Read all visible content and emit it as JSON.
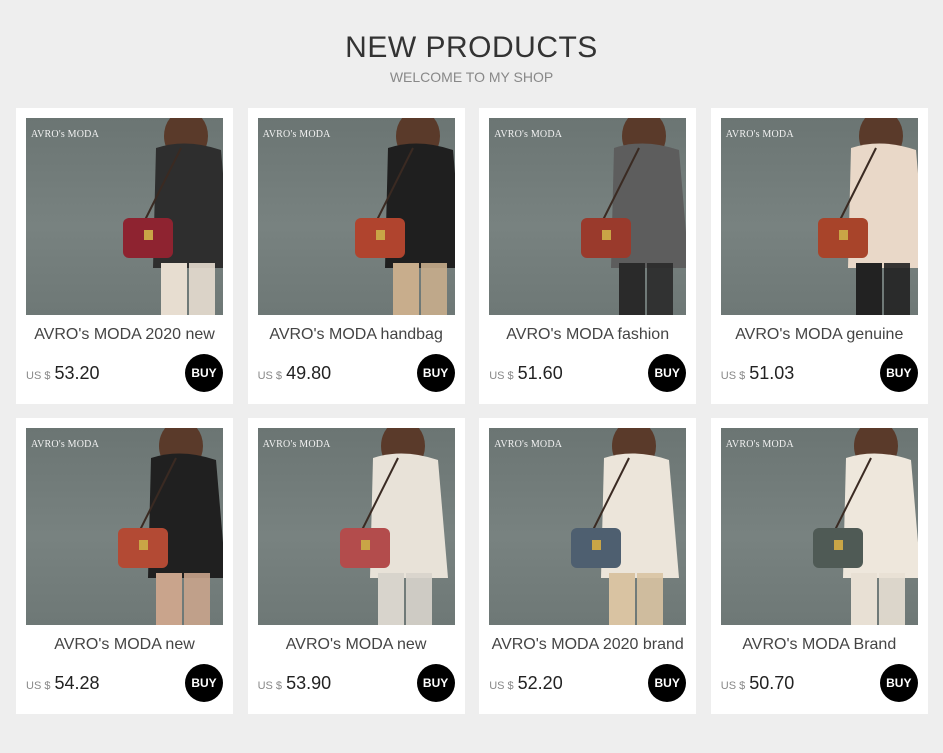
{
  "header": {
    "title": "NEW PRODUCTS",
    "subtitle": "WELCOME TO MY SHOP"
  },
  "buy_label": "BUY",
  "currency": "US $",
  "products": [
    {
      "name": "AVRO's MODA 2020 new",
      "price": "53.20",
      "watermark": "AVRO's MODA",
      "bag_color": "#8e2330",
      "coat_color": "#2e2e2e",
      "pants_color": "#e7ddd0"
    },
    {
      "name": "AVRO's MODA handbag",
      "price": "49.80",
      "watermark": "AVRO's MODA",
      "bag_color": "#b0442e",
      "coat_color": "#1f1f1f",
      "pants_color": "#c8ad8c"
    },
    {
      "name": "AVRO's MODA fashion",
      "price": "51.60",
      "watermark": "AVRO's MODA",
      "bag_color": "#9a3a2c",
      "coat_color": "#5d5d5d",
      "pants_color": "#2a2a2a"
    },
    {
      "name": "AVRO's MODA genuine",
      "price": "51.03",
      "watermark": "AVRO's MODA",
      "bag_color": "#a8442a",
      "coat_color": "#e9d8c8",
      "pants_color": "#222222"
    },
    {
      "name": "AVRO's MODA new",
      "price": "54.28",
      "watermark": "AVRO's MODA",
      "bag_color": "#b34a34",
      "coat_color": "#202020",
      "pants_color": "#c9a48c"
    },
    {
      "name": "AVRO's MODA new",
      "price": "53.90",
      "watermark": "AVRO's MODA",
      "bag_color": "#b34c4c",
      "coat_color": "#e8e2d8",
      "pants_color": "#d8d4cc"
    },
    {
      "name": "AVRO's MODA 2020 brand",
      "price": "52.20",
      "watermark": "AVRO's MODA",
      "bag_color": "#4e5f70",
      "coat_color": "#ece5da",
      "pants_color": "#d9c3a2"
    },
    {
      "name": "AVRO's MODA Brand",
      "price": "50.70",
      "watermark": "AVRO's MODA",
      "bag_color": "#4f5a55",
      "coat_color": "#eee7dc",
      "pants_color": "#e8e0d4"
    }
  ]
}
